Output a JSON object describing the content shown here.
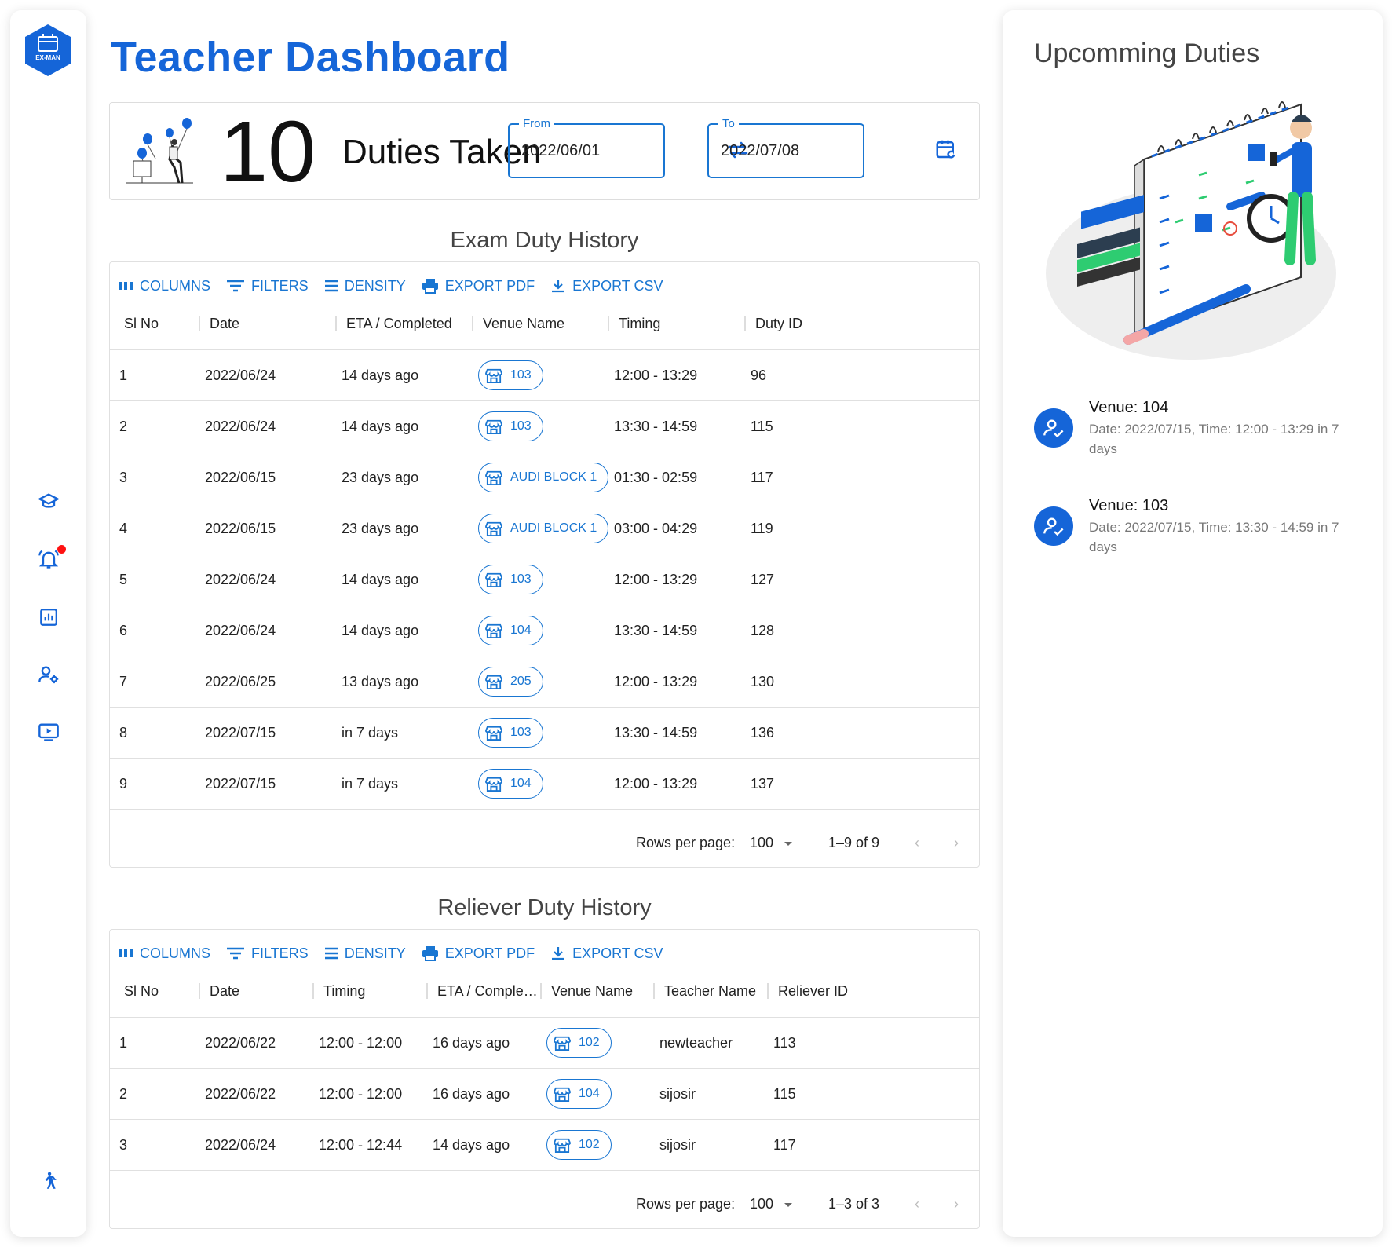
{
  "app": {
    "logo_text": "EX-MAN"
  },
  "page": {
    "title": "Teacher Dashboard"
  },
  "summary": {
    "count": "10",
    "label": "Duties Taken",
    "from_label": "From",
    "from_value": "2022/06/01",
    "to_label": "To",
    "to_value": "2022/07/08"
  },
  "toolbar": {
    "columns": "COLUMNS",
    "filters": "FILTERS",
    "density": "DENSITY",
    "export_pdf": "EXPORT PDF",
    "export_csv": "EXPORT CSV"
  },
  "exam": {
    "title": "Exam Duty History",
    "headers": [
      "Sl No",
      "Date",
      "ETA / Completed",
      "Venue Name",
      "Timing",
      "Duty ID"
    ],
    "rows": [
      {
        "sl": "1",
        "date": "2022/06/24",
        "eta": "14 days ago",
        "venue": "103",
        "timing": "12:00 - 13:29",
        "id": "96"
      },
      {
        "sl": "2",
        "date": "2022/06/24",
        "eta": "14 days ago",
        "venue": "103",
        "timing": "13:30 - 14:59",
        "id": "115"
      },
      {
        "sl": "3",
        "date": "2022/06/15",
        "eta": "23 days ago",
        "venue": "AUDI BLOCK 1",
        "timing": "01:30 - 02:59",
        "id": "117"
      },
      {
        "sl": "4",
        "date": "2022/06/15",
        "eta": "23 days ago",
        "venue": "AUDI BLOCK 1",
        "timing": "03:00 - 04:29",
        "id": "119"
      },
      {
        "sl": "5",
        "date": "2022/06/24",
        "eta": "14 days ago",
        "venue": "103",
        "timing": "12:00 - 13:29",
        "id": "127"
      },
      {
        "sl": "6",
        "date": "2022/06/24",
        "eta": "14 days ago",
        "venue": "104",
        "timing": "13:30 - 14:59",
        "id": "128"
      },
      {
        "sl": "7",
        "date": "2022/06/25",
        "eta": "13 days ago",
        "venue": "205",
        "timing": "12:00 - 13:29",
        "id": "130"
      },
      {
        "sl": "8",
        "date": "2022/07/15",
        "eta": "in 7 days",
        "venue": "103",
        "timing": "13:30 - 14:59",
        "id": "136"
      },
      {
        "sl": "9",
        "date": "2022/07/15",
        "eta": "in 7 days",
        "venue": "104",
        "timing": "12:00 - 13:29",
        "id": "137"
      }
    ],
    "rows_per_page_label": "Rows per page:",
    "rows_per_page": "100",
    "range": "1–9 of 9"
  },
  "reliever": {
    "title": "Reliever Duty History",
    "headers": [
      "Sl No",
      "Date",
      "Timing",
      "ETA / Comple…",
      "Venue Name",
      "Teacher Name",
      "Reliever ID"
    ],
    "rows": [
      {
        "sl": "1",
        "date": "2022/06/22",
        "timing": "12:00 - 12:00",
        "eta": "16 days ago",
        "venue": "102",
        "teacher": "newteacher",
        "id": "113"
      },
      {
        "sl": "2",
        "date": "2022/06/22",
        "timing": "12:00 - 12:00",
        "eta": "16 days ago",
        "venue": "104",
        "teacher": "sijosir",
        "id": "115"
      },
      {
        "sl": "3",
        "date": "2022/06/24",
        "timing": "12:00 - 12:44",
        "eta": "14 days ago",
        "venue": "102",
        "teacher": "sijosir",
        "id": "117"
      }
    ],
    "rows_per_page_label": "Rows per page:",
    "rows_per_page": "100",
    "range": "1–3 of 3"
  },
  "upcoming": {
    "title": "Upcomming Duties",
    "items": [
      {
        "venue": "Venue: 104",
        "desc": "Date: 2022/07/15, Time: 12:00 - 13:29 in 7 days"
      },
      {
        "venue": "Venue: 103",
        "desc": "Date: 2022/07/15, Time: 13:30 - 14:59 in 7 days"
      }
    ]
  },
  "icons": {
    "nav": [
      "graduation-cap-icon",
      "notification-bell-icon",
      "bar-chart-icon",
      "user-settings-icon",
      "video-play-icon",
      "walking-person-icon"
    ],
    "accent": "#1565d8",
    "link": "#1976d2",
    "badge": "#ff1111"
  }
}
